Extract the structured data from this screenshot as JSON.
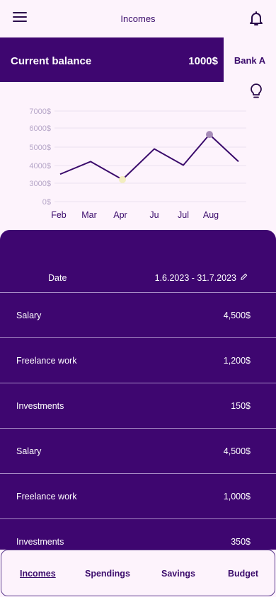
{
  "header": {
    "title": "Incomes",
    "menu_icon": "hamburger-menu-icon",
    "notification_icon": "bell-icon"
  },
  "balance": {
    "label": "Current balance",
    "amount": "1000$"
  },
  "bank": {
    "label": "Bank A"
  },
  "tip_icon": "lightbulb-icon",
  "colors": {
    "accent": "#3e0670",
    "background": "#fdf3fc",
    "line": "#3a0a6b",
    "divider": "#a88bc6",
    "highlight_point": "#f3eec0",
    "peak_point": "#a68bb8"
  },
  "chart_data": {
    "type": "line",
    "x": [
      "Feb",
      "Mar",
      "Apr",
      "Ju",
      "Jul",
      "Aug"
    ],
    "y_ticks": [
      "7000$",
      "6000$",
      "5000$",
      "4000$",
      "3000$",
      "0$"
    ],
    "ylim": [
      0,
      7000
    ],
    "grid": true,
    "series": [
      {
        "values": [
          3500,
          4200,
          3200,
          4900,
          4000,
          5700,
          4200
        ]
      }
    ],
    "markers": [
      {
        "point_index": 2,
        "color": "#f3eec0"
      },
      {
        "point_index": 5,
        "color": "#a68bb8"
      }
    ]
  },
  "table": {
    "date_label": "Date",
    "date_range": "1.6.2023 - 31.7.2023",
    "edit_icon": "pencil-icon",
    "rows": [
      {
        "name": "Salary",
        "amount": "4,500$"
      },
      {
        "name": "Freelance work",
        "amount": "1,200$"
      },
      {
        "name": "Investments",
        "amount": "150$"
      },
      {
        "name": "Salary",
        "amount": "4,500$"
      },
      {
        "name": "Freelance work",
        "amount": "1,000$"
      },
      {
        "name": "Investments",
        "amount": "350$"
      }
    ]
  },
  "nav": {
    "items": [
      {
        "label": "Incomes",
        "active": true
      },
      {
        "label": "Spendings",
        "active": false
      },
      {
        "label": "Savings",
        "active": false
      },
      {
        "label": "Budget",
        "active": false
      }
    ]
  }
}
